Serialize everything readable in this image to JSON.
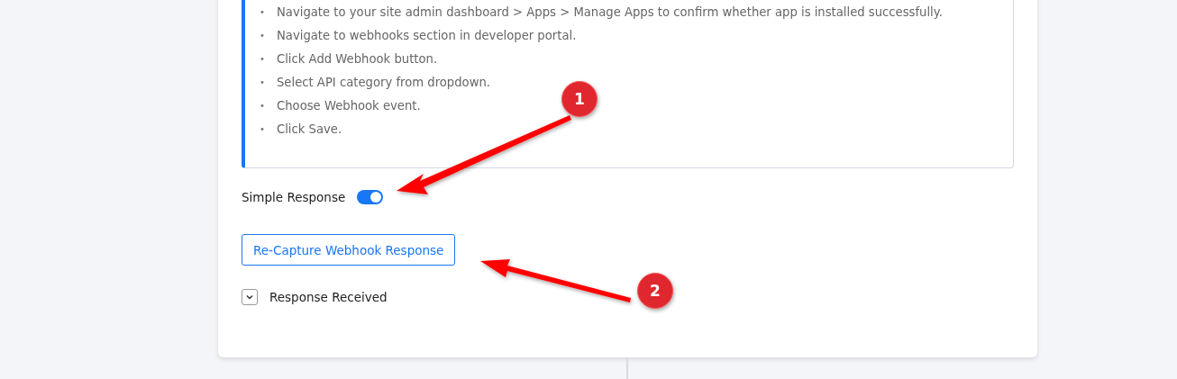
{
  "instructions": [
    {
      "bullet": "•",
      "text": "Navigate to your site admin dashboard > Apps > Manage Apps to confirm whether app is installed successfully."
    },
    {
      "bullet": "•",
      "text": "Navigate to webhooks section in developer portal."
    },
    {
      "bullet": "•",
      "text": "Click Add Webhook button."
    },
    {
      "bullet": "•",
      "text": "Select API category from dropdown."
    },
    {
      "bullet": "•",
      "text": "Choose Webhook event."
    },
    {
      "bullet": "•",
      "text": "Click Save."
    }
  ],
  "simple_response": {
    "label": "Simple Response",
    "on": true
  },
  "recapture_button": "Re-Capture Webhook Response",
  "response_received": {
    "label": "Response Received",
    "expanded": false
  },
  "annotations": [
    {
      "label": "1"
    },
    {
      "label": "2"
    }
  ]
}
